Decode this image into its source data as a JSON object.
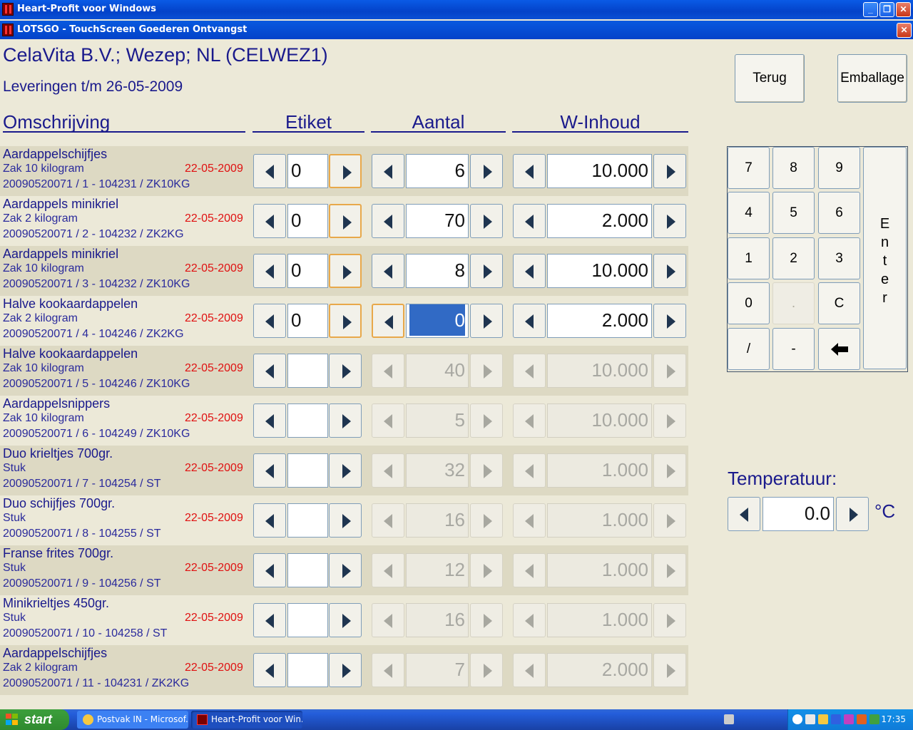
{
  "window": {
    "title": "Heart-Profit voor Windows",
    "sub_title": "LOTSGO - TouchScreen Goederen Ontvangst"
  },
  "header": {
    "supplier": "CelaVita B.V.; Wezep; NL (CELWEZ1)",
    "deliveries": "Leveringen t/m 26-05-2009"
  },
  "columns": {
    "description": "Omschrijving",
    "label": "Etiket",
    "quantity": "Aantal",
    "content": "W-Inhoud"
  },
  "buttons": {
    "back": "Terug",
    "packaging": "Emballage"
  },
  "keypad": {
    "k7": "7",
    "k8": "8",
    "k9": "9",
    "k4": "4",
    "k5": "5",
    "k6": "6",
    "k1": "1",
    "k2": "2",
    "k3": "3",
    "k0": "0",
    "kdot": ".",
    "kc": "C",
    "kslash": "/",
    "kminus": "-",
    "enter_letters": [
      "E",
      "n",
      "t",
      "e",
      "r"
    ]
  },
  "temperature": {
    "label": "Temperatuur:",
    "value": "0.0",
    "unit": "°C"
  },
  "rows": [
    {
      "name": "Aardappelschijfjes",
      "unit": "Zak 10 kilogram",
      "date": "22-05-2009",
      "code": "20090520071 / 1 - 104231 / ZK10KG",
      "label": "0",
      "quantity": "6",
      "content": "10.000"
    },
    {
      "name": "Aardappels minikriel",
      "unit": "Zak 2 kilogram",
      "date": "22-05-2009",
      "code": "20090520071 / 2 - 104232 / ZK2KG",
      "label": "0",
      "quantity": "70",
      "content": "2.000"
    },
    {
      "name": "Aardappels minikriel",
      "unit": "Zak 10 kilogram",
      "date": "22-05-2009",
      "code": "20090520071 / 3 - 104232 / ZK10KG",
      "label": "0",
      "quantity": "8",
      "content": "10.000"
    },
    {
      "name": "Halve kookaardappelen",
      "unit": "Zak 2 kilogram",
      "date": "22-05-2009",
      "code": "20090520071 / 4 - 104246 / ZK2KG",
      "label": "0",
      "quantity": "0",
      "content": "2.000"
    },
    {
      "name": "Halve kookaardappelen",
      "unit": "Zak 10 kilogram",
      "date": "22-05-2009",
      "code": "20090520071 / 5 - 104246 / ZK10KG",
      "label": "",
      "quantity": "40",
      "content": "10.000"
    },
    {
      "name": "Aardappelsnippers",
      "unit": "Zak 10 kilogram",
      "date": "22-05-2009",
      "code": "20090520071 / 6 - 104249 / ZK10KG",
      "label": "",
      "quantity": "5",
      "content": "10.000"
    },
    {
      "name": "Duo krieltjes 700gr.",
      "unit": "Stuk",
      "date": "22-05-2009",
      "code": "20090520071 / 7 - 104254 / ST",
      "label": "",
      "quantity": "32",
      "content": "1.000"
    },
    {
      "name": "Duo schijfjes 700gr.",
      "unit": "Stuk",
      "date": "22-05-2009",
      "code": "20090520071 / 8 - 104255 / ST",
      "label": "",
      "quantity": "16",
      "content": "1.000"
    },
    {
      "name": "Franse frites 700gr.",
      "unit": "Stuk",
      "date": "22-05-2009",
      "code": "20090520071 / 9 - 104256 / ST",
      "label": "",
      "quantity": "12",
      "content": "1.000"
    },
    {
      "name": "Minikrieltjes 450gr.",
      "unit": "Stuk",
      "date": "22-05-2009",
      "code": "20090520071 / 10 - 104258 / ST",
      "label": "",
      "quantity": "16",
      "content": "1.000"
    },
    {
      "name": "Aardappelschijfjes",
      "unit": "Zak 2 kilogram",
      "date": "22-05-2009",
      "code": "20090520071 / 11 - 104231 / ZK2KG",
      "label": "",
      "quantity": "7",
      "content": "2.000"
    }
  ],
  "taskbar": {
    "start": "start",
    "task1": "Postvak IN - Microsof...",
    "task2": "Heart-Profit voor Win...",
    "clock": "17:35"
  },
  "colors": {
    "title_blue": "#0A5BE6",
    "text_navy": "#1A1A8C",
    "date_red": "#E01010",
    "selection_blue": "#316AC5"
  }
}
